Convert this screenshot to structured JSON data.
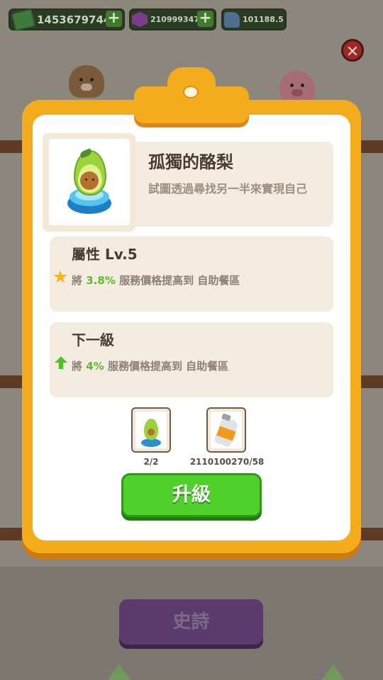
{
  "currency_bar": {
    "cash": "1453679744",
    "gems": "2109993472",
    "likes": "101188.5",
    "plus_symbol": "+"
  },
  "close_symbol": "✕",
  "item": {
    "name": "孤獨的酪梨",
    "description": "試圖透過尋找另一半來實現自己"
  },
  "attribute": {
    "title": "屬性 Lv.5",
    "prefix": "將",
    "value": "3.8%",
    "suffix": "服務價格提高到 自助餐區"
  },
  "next_level": {
    "title": "下一級",
    "prefix": "將",
    "value": "4%",
    "suffix": "服務價格提高到 自助餐區"
  },
  "requirements": {
    "avocado_count": "2/2",
    "bottle_count": "2110100270/58"
  },
  "upgrade_label": "升級",
  "epic_label": "史詩",
  "colors": {
    "board": "#f5ac1c",
    "upgrade": "#4fd02a",
    "value_green": "#5db82e",
    "epic": "#5b3a6e"
  }
}
